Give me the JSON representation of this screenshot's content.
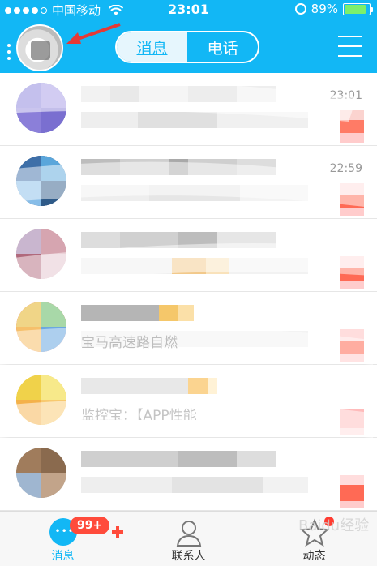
{
  "status_bar": {
    "carrier": "中国移动",
    "time": "23:01",
    "battery": "89%",
    "battery_level": 0.89,
    "icons": [
      "wifi-icon",
      "alarm-icon",
      "battery-icon",
      "signal-dots-icon"
    ]
  },
  "nav": {
    "tabs": [
      {
        "label": "消息",
        "active": true
      },
      {
        "label": "电话",
        "active": false
      }
    ],
    "icons": [
      "avatar-icon",
      "menu-icon"
    ]
  },
  "messages": [
    {
      "time": "23:01"
    },
    {
      "time": "22:59"
    },
    {
      "time": ""
    },
    {
      "time": ""
    },
    {
      "time": ""
    },
    {
      "time": ""
    }
  ],
  "partial_texts": {
    "row5_msg": "监控宝：【APP性能",
    "row4_msg": "宝马高速路自燃"
  },
  "tabbar": {
    "tabs": [
      {
        "label": "消息",
        "active": true,
        "icon": "message-icon"
      },
      {
        "label": "联系人",
        "active": false,
        "icon": "contacts-icon"
      },
      {
        "label": "动态",
        "active": false,
        "icon": "star-icon"
      }
    ],
    "badge": "99+"
  },
  "watermark": "Baidu经验",
  "colors": {
    "accent": "#12b7f5",
    "badge": "#ff4b3b"
  }
}
